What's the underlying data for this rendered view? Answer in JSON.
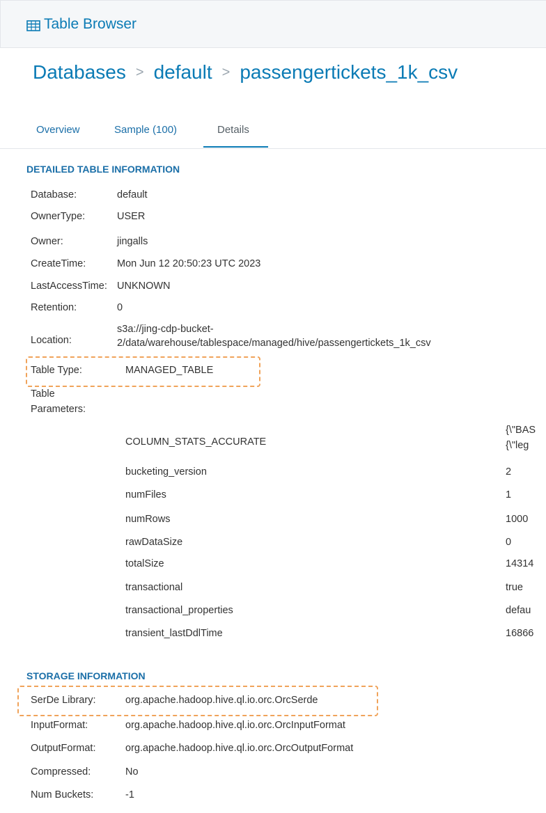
{
  "header": {
    "title": "Table Browser",
    "icon": "table-icon"
  },
  "breadcrumb": {
    "items": [
      "Databases",
      "default",
      "passengertickets_1k_csv"
    ],
    "separator": ">"
  },
  "tabs": [
    {
      "label": "Overview",
      "active": false
    },
    {
      "label": "Sample (100)",
      "active": false
    },
    {
      "label": "Details",
      "active": true
    }
  ],
  "detailed": {
    "section_title": "DETAILED TABLE INFORMATION",
    "rows": [
      {
        "label": "Database:",
        "value": "default"
      },
      {
        "label": "OwnerType:",
        "value": "USER"
      },
      {
        "label": "Owner:",
        "value": "jingalls"
      },
      {
        "label": "CreateTime:",
        "value": "Mon Jun 12 20:50:23 UTC 2023"
      },
      {
        "label": "LastAccessTime:",
        "value": "UNKNOWN"
      },
      {
        "label": "Retention:",
        "value": "0"
      },
      {
        "label": "Location:",
        "value_line1": "s3a://jing-cdp-bucket-",
        "value_line2": "2/data/warehouse/tablespace/managed/hive/passengertickets_1k_csv"
      },
      {
        "label": "Table Type:",
        "value": "MANAGED_TABLE"
      },
      {
        "label_line1": "Table",
        "label_line2": "Parameters:"
      }
    ],
    "parameters": [
      {
        "key": "COLUMN_STATS_ACCURATE",
        "value_line1": "{\\\"BAS",
        "value_line2": "{\\\"leg"
      },
      {
        "key": "bucketing_version",
        "value": "2"
      },
      {
        "key": "numFiles",
        "value": "1"
      },
      {
        "key": "numRows",
        "value": "1000"
      },
      {
        "key": "rawDataSize",
        "value": "0"
      },
      {
        "key": "totalSize",
        "value": "14314"
      },
      {
        "key": "transactional",
        "value": "true"
      },
      {
        "key": "transactional_properties",
        "value": "defau"
      },
      {
        "key": "transient_lastDdlTime",
        "value": "16866"
      }
    ]
  },
  "storage": {
    "section_title": "STORAGE INFORMATION",
    "rows": [
      {
        "label": "SerDe Library:",
        "value": "org.apache.hadoop.hive.ql.io.orc.OrcSerde"
      },
      {
        "label": "InputFormat:",
        "value": "org.apache.hadoop.hive.ql.io.orc.OrcInputFormat"
      },
      {
        "label": "OutputFormat:",
        "value": "org.apache.hadoop.hive.ql.io.orc.OrcOutputFormat"
      },
      {
        "label": "Compressed:",
        "value": "No"
      },
      {
        "label": "Num Buckets:",
        "value": "-1"
      }
    ]
  },
  "colors": {
    "accent": "#0b7bb5",
    "highlight": "#f0a35a",
    "topbar_bg": "#f5f7f9"
  }
}
